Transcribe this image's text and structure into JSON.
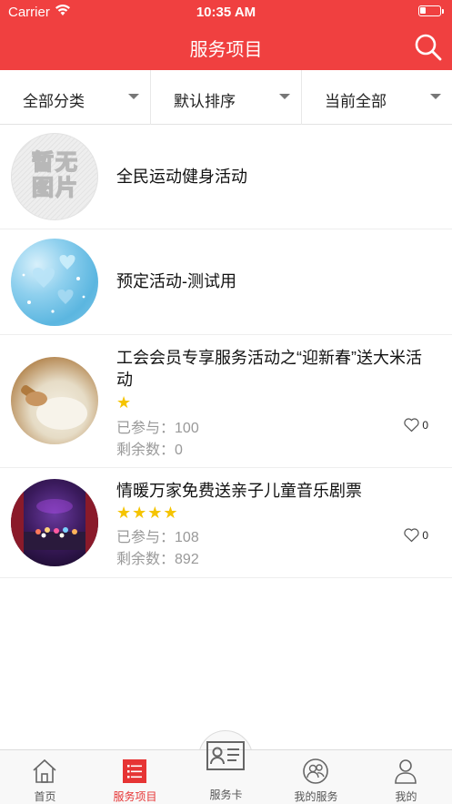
{
  "status_bar": {
    "carrier": "Carrier",
    "time": "10:35 AM",
    "battery_level": 0.3
  },
  "header": {
    "title": "服务项目",
    "search_icon": "search-icon"
  },
  "filters": [
    {
      "label": "全部分类"
    },
    {
      "label": "默认排序"
    },
    {
      "label": "当前全部"
    }
  ],
  "items": [
    {
      "title": "全民运动健身活动",
      "image": "placeholder-no-image",
      "placeholder_text": [
        "暂无",
        "图片"
      ]
    },
    {
      "title": "预定活动-测试用",
      "image": "blue-hearts-photo"
    },
    {
      "title": "工会会员专享服务活动之“迎新春”送大米活动",
      "image": "rice-sack-photo",
      "stars": "★",
      "rating": 1,
      "joined_label": "已参与：",
      "joined": "100",
      "remaining_label": "剩余数：",
      "remaining": "0",
      "likes": "0"
    },
    {
      "title": "情暖万家免费送亲子儿童音乐剧票",
      "image": "theater-stage-photo",
      "stars": "★★★★",
      "rating": 4,
      "joined_label": "已参与：",
      "joined": "108",
      "remaining_label": "剩余数：",
      "remaining": "892",
      "likes": "0"
    }
  ],
  "tabbar": [
    {
      "label": "首页",
      "icon": "home-icon",
      "active": false
    },
    {
      "label": "服务项目",
      "icon": "list-icon",
      "active": true
    },
    {
      "label": "服务卡",
      "icon": "card-icon",
      "active": false
    },
    {
      "label": "我的服务",
      "icon": "users-icon",
      "active": false
    },
    {
      "label": "我的",
      "icon": "person-icon",
      "active": false
    }
  ],
  "colors": {
    "brand": "#f04040",
    "active_tab": "#e63434",
    "star": "#f5c400",
    "meta_text": "#999999"
  }
}
